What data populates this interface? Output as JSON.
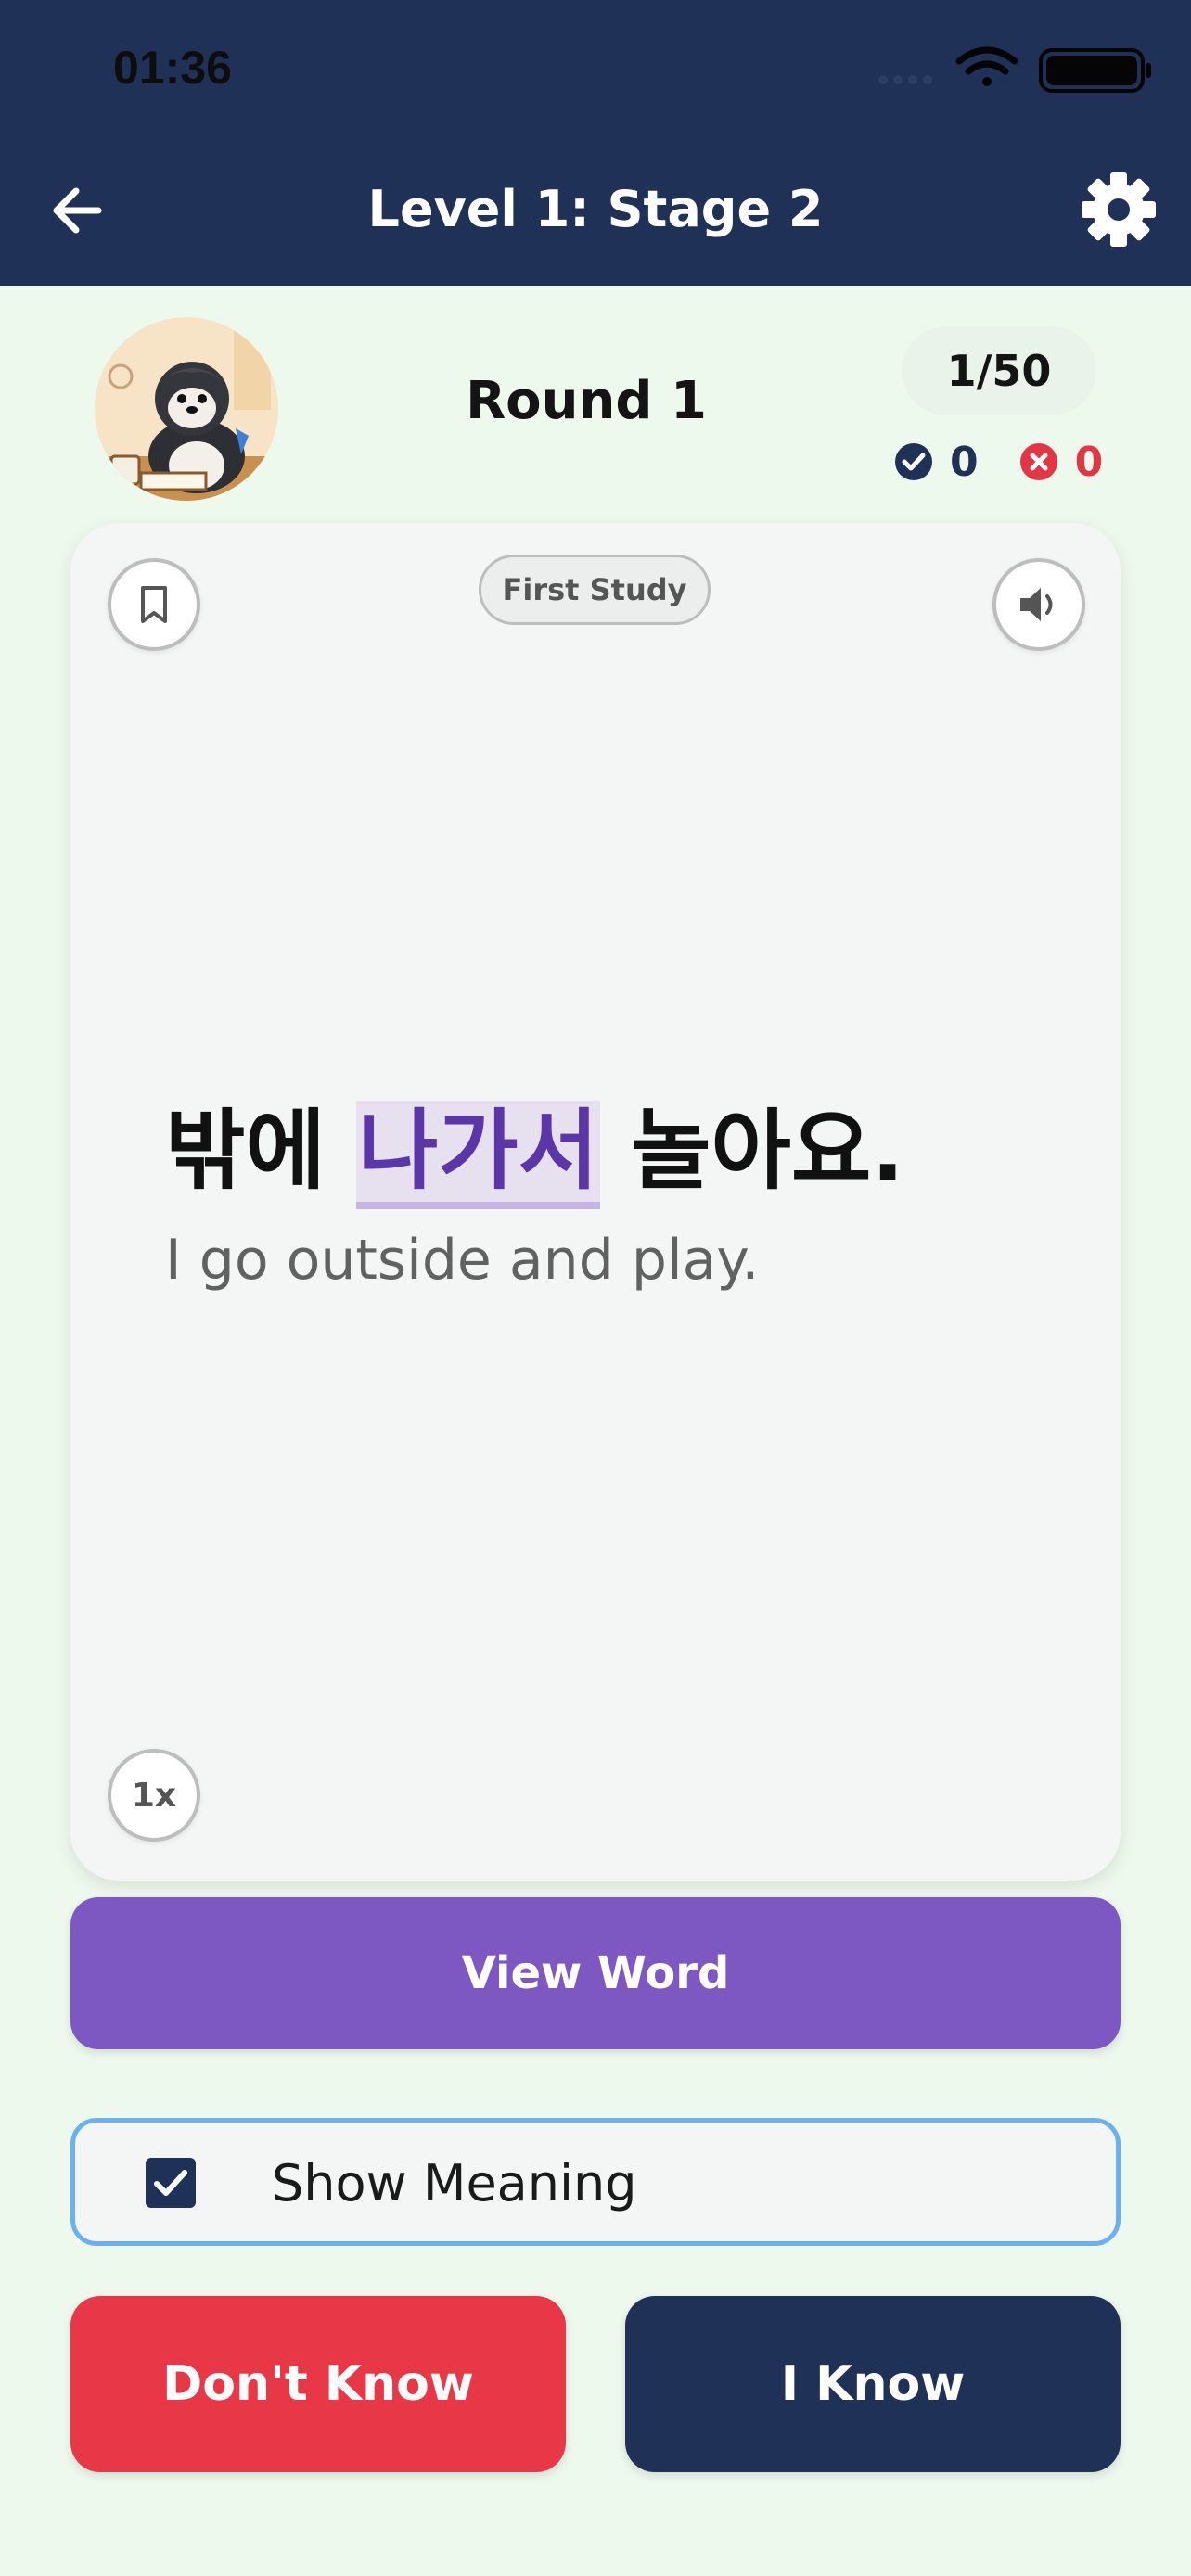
{
  "status_bar": {
    "time": "01:36",
    "icons": [
      "signal-icon",
      "wifi-icon",
      "battery-icon"
    ]
  },
  "header": {
    "title": "Level 1: Stage 2",
    "back_icon": "arrow-left-icon",
    "settings_icon": "gear-icon",
    "background": "#1f3157"
  },
  "round": {
    "label": "Round 1",
    "progress": "1/50",
    "known_count": "0",
    "unknown_count": "0"
  },
  "card": {
    "badge": "First Study",
    "sentence_before": "밖에 ",
    "sentence_highlight": "나가서",
    "sentence_after": " 놀아요.",
    "meaning": "I go outside and play.",
    "speed": "1x",
    "bookmark_icon": "bookmark-icon",
    "sound_icon": "speaker-icon"
  },
  "actions": {
    "view_word": "View Word",
    "show_meaning": "Show Meaning",
    "show_meaning_checked": true,
    "dont_know": "Don't Know",
    "know": "I Know"
  },
  "colors": {
    "primary_dark": "#1f3157",
    "accent_purple": "#7d58c2",
    "danger_red": "#e83747",
    "highlight_purple": "#5a36a8",
    "focus_blue": "#6bb0f2",
    "background": "#eef9ee"
  }
}
